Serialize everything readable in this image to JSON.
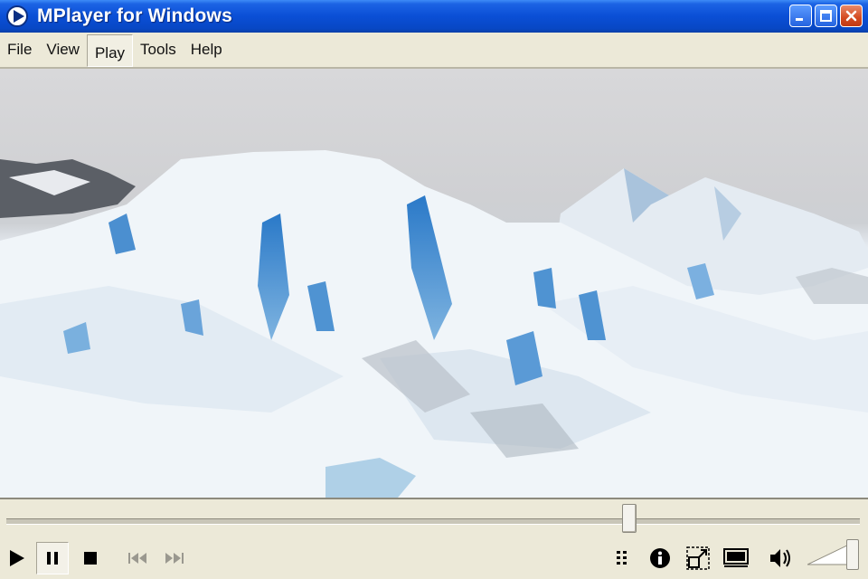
{
  "window": {
    "title": "MPlayer for Windows",
    "title_buttons": [
      "minimize",
      "maximize",
      "close"
    ]
  },
  "menu": {
    "items": [
      {
        "label": "File",
        "active": false
      },
      {
        "label": "View",
        "active": false
      },
      {
        "label": "Play",
        "active": true
      },
      {
        "label": "Tools",
        "active": false
      },
      {
        "label": "Help",
        "active": false
      }
    ]
  },
  "playback": {
    "position_fraction": 0.73,
    "volume_fraction": 1.0,
    "state": "paused"
  },
  "controls": {
    "transport": [
      "play-icon",
      "pause-icon",
      "stop-icon",
      "skip-back-icon",
      "skip-forward-icon"
    ],
    "right": [
      "playlist-icon",
      "info-icon",
      "fullscreen-icon",
      "compact-view-icon",
      "speaker-icon"
    ]
  },
  "colors": {
    "titlebar": "#0a4fd6",
    "face": "#ece9d8",
    "close": "#d44a21"
  }
}
